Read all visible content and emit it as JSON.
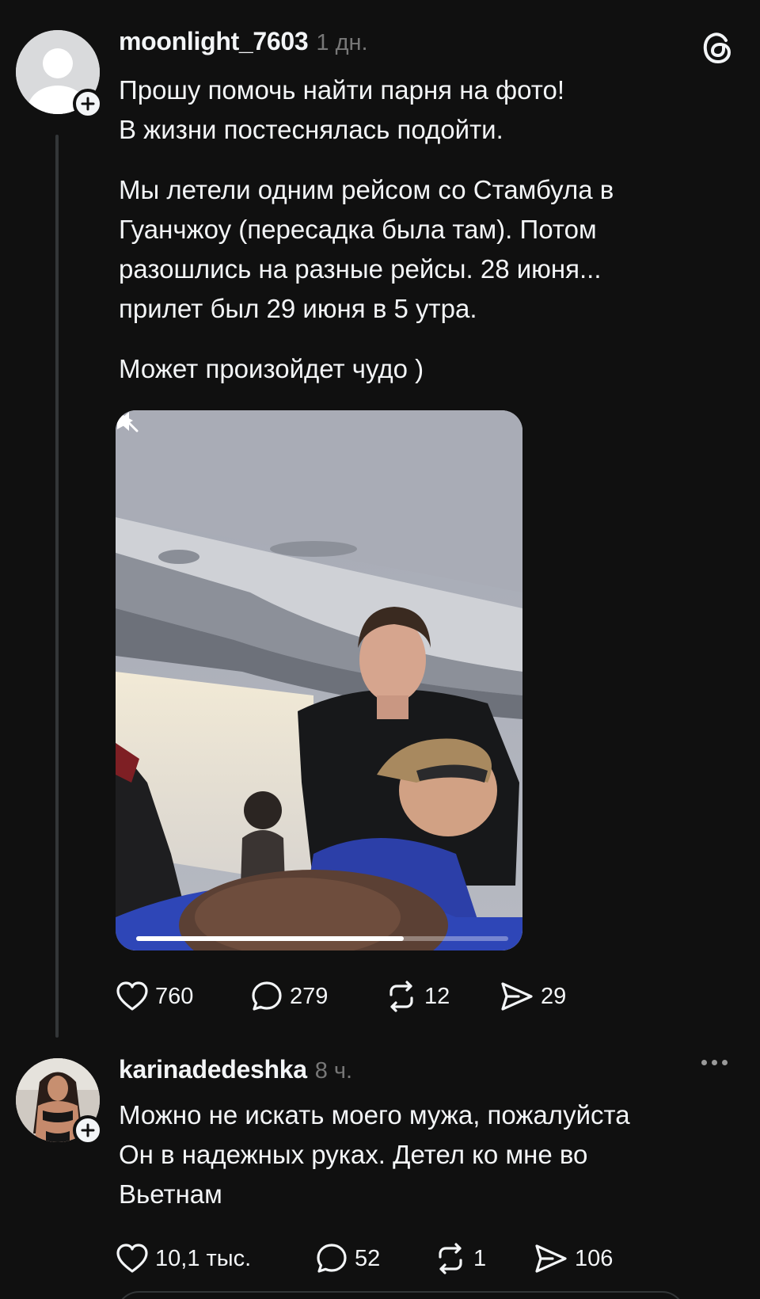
{
  "post": {
    "username": "moonlight_7603",
    "time": "1 дн.",
    "text": [
      "Прошу помочь найти парня на фото!",
      "В жизни постеснялась подойти.",
      "",
      "Мы летели одним рейсом со Стамбула в",
      "Гуанчжоу (пересадка была там). Потом",
      "разошлись на разные рейсы. 28 июня...",
      "прилет был 29 июня в 5 утра.",
      "",
      "Может произойдет чудо )"
    ],
    "video": {
      "progress": 0.72,
      "muted": true
    },
    "stats": {
      "likes": "760",
      "comments": "279",
      "reposts": "12",
      "shares": "29"
    }
  },
  "reply": {
    "username": "karinadedeshka",
    "time": "8 ч.",
    "text": [
      "Можно не искать моего мужа, пожалуйста",
      "Он в надежных руках. Детел ко мне во",
      "Вьетнам"
    ],
    "stats": {
      "likes": "10,1 тыс.",
      "comments": "52",
      "reposts": "1",
      "shares": "106"
    }
  },
  "icons": {
    "app_logo": "threads-logo-icon",
    "like": "heart-icon",
    "comment": "comment-bubble-icon",
    "repost": "repost-icon",
    "share": "share-icon",
    "more": "more-dots-icon",
    "follow": "plus-icon"
  },
  "colors": {
    "background": "#101010",
    "text": "#f3f5f7",
    "secondary": "#777777",
    "line": "#333638"
  }
}
